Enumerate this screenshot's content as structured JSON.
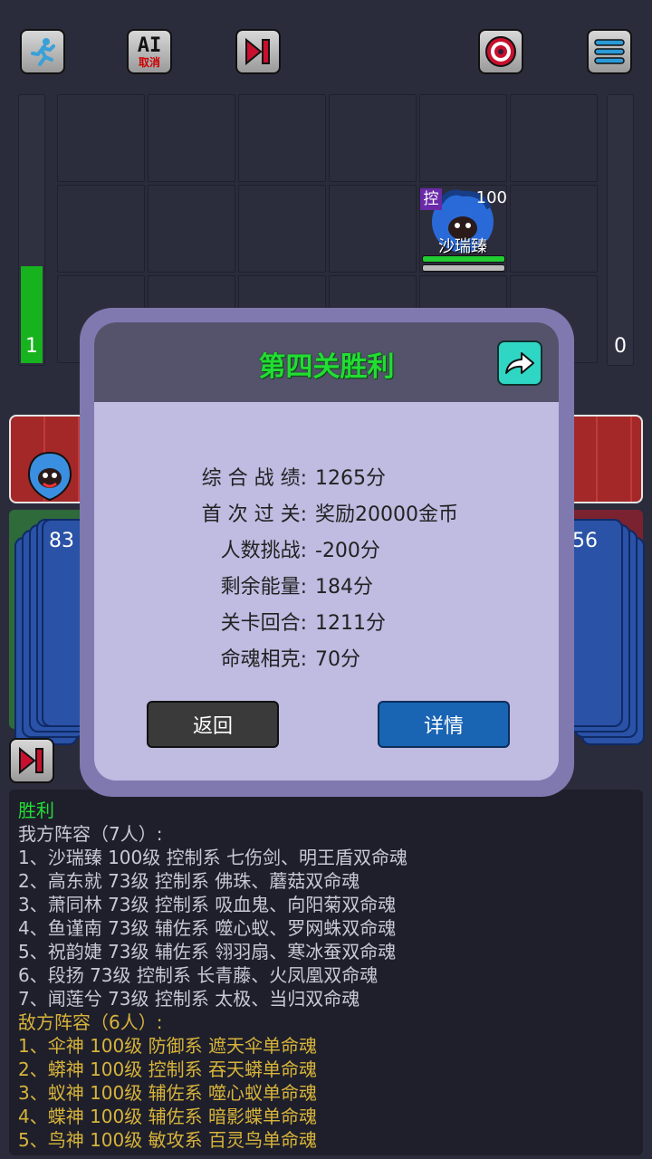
{
  "topbar": {
    "ai_label": "AI",
    "ai_cancel_label": "取消"
  },
  "board": {
    "left_energy": "1",
    "left_energy_fraction": 0.36,
    "right_energy": "0",
    "unit": {
      "badge": "控",
      "hp": "100",
      "name": "沙瑞臻"
    },
    "left_deck_count": "83",
    "right_deck_count": "56"
  },
  "modal": {
    "title": "第四关胜利",
    "stats": [
      {
        "label": "综 合 战 绩:",
        "value": "1265分"
      },
      {
        "label": "首 次 过 关:",
        "value": "奖励20000金币"
      },
      {
        "label": "人数挑战:",
        "value": "-200分"
      },
      {
        "label": "剩余能量:",
        "value": "184分"
      },
      {
        "label": "关卡回合:",
        "value": "1211分"
      },
      {
        "label": "命魂相克:",
        "value": "70分"
      }
    ],
    "back_label": "返回",
    "detail_label": "详情"
  },
  "log": {
    "result": "胜利",
    "our_header": "我方阵容（7人）:",
    "our_lines": [
      "1、沙瑞臻 100级 控制系 七伤剑、明王盾双命魂",
      "2、高东就 73级 控制系 佛珠、蘑菇双命魂",
      "3、萧同林 73级 控制系 吸血鬼、向阳菊双命魂",
      "4、鱼谨南 73级 辅佐系 噬心蚁、罗网蛛双命魂",
      "5、祝韵婕 73级 辅佐系 翎羽扇、寒冰蚕双命魂",
      "6、段扬 73级 控制系 长青藤、火凤凰双命魂",
      "7、闻莲兮 73级 控制系 太极、当归双命魂"
    ],
    "enemy_header": "敌方阵容（6人）:",
    "enemy_lines": [
      "1、伞神 100级 防御系 遮天伞单命魂",
      "2、蟒神 100级 控制系 吞天蟒单命魂",
      "3、蚁神 100级 辅佐系 噬心蚁单命魂",
      "4、蝶神 100级 辅佐系 暗影蝶单命魂",
      "5、鸟神 100级 敏攻系 百灵鸟单命魂"
    ]
  },
  "colors": {
    "green_text": "#22dd33",
    "enemy_text": "#d8b43a",
    "log_text": "#c9c9d4",
    "detail_button": "#1a64b4"
  }
}
